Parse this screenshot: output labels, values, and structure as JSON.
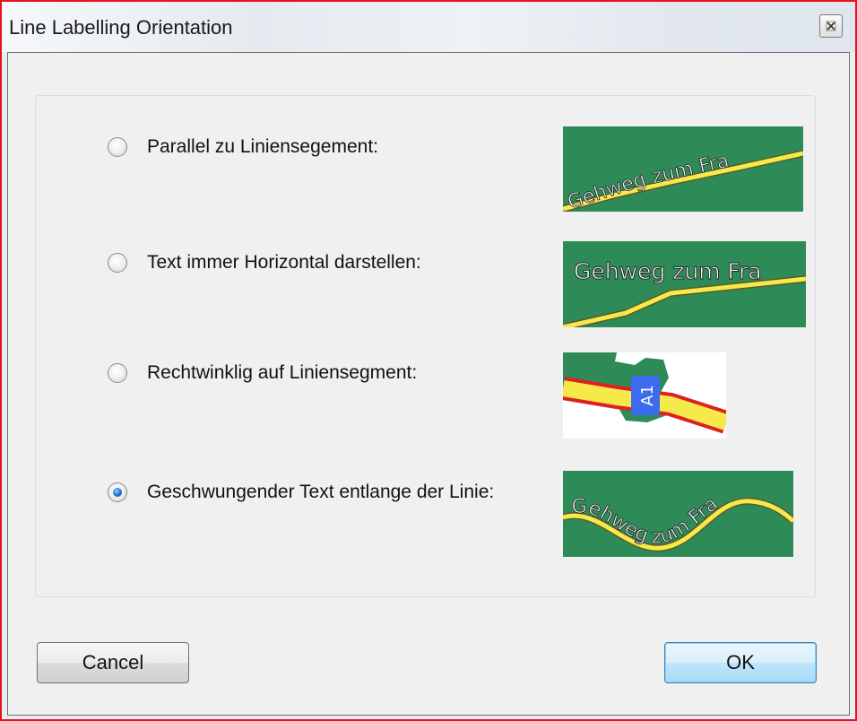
{
  "window": {
    "title": "Line Labelling Orientation"
  },
  "options": [
    {
      "label": "Parallel zu Liniensegement:",
      "checked": false,
      "preview_text": "Gehweg zum Fra"
    },
    {
      "label": "Text immer Horizontal darstellen:",
      "checked": false,
      "preview_text": "Gehweg zum Fra"
    },
    {
      "label": "Rechtwinklig auf Liniensegment:",
      "checked": false,
      "preview_text": "A1"
    },
    {
      "label": "Geschwungender Text entlange der Linie:",
      "checked": true,
      "preview_text": "Gehweg zum Fra"
    }
  ],
  "buttons": {
    "cancel": "Cancel",
    "ok": "OK"
  },
  "colors": {
    "map_green": "#2e8b57",
    "road_yellow": "#f5e94b",
    "road_red": "#e02020",
    "shield_blue": "#3b6cf0",
    "dialog_bg": "#f0f0f0",
    "window_border": "#e8121c"
  }
}
